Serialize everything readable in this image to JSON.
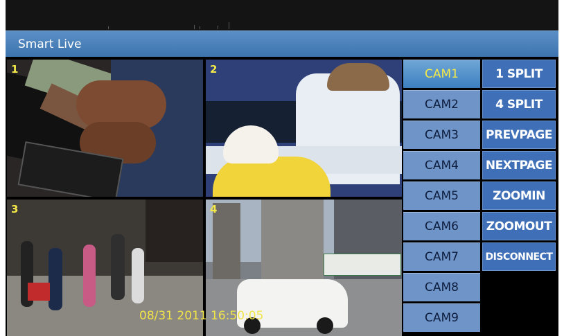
{
  "window": {
    "title": "Smart Live"
  },
  "tiles": [
    {
      "label": "1"
    },
    {
      "label": "2"
    },
    {
      "label": "3"
    },
    {
      "label": "4"
    }
  ],
  "overlay": {
    "timestamp": "08/31 2011 16:50:05"
  },
  "cameras": {
    "active": "CAM1",
    "items": [
      "CAM1",
      "CAM2",
      "CAM3",
      "CAM4",
      "CAM5",
      "CAM6",
      "CAM7",
      "CAM8",
      "CAM9"
    ]
  },
  "controls": [
    "1 SPLIT",
    "4 SPLIT",
    "PREVPAGE",
    "NEXTPAGE",
    "ZOOMIN",
    "ZOOMOUT",
    "DISCONNECT"
  ],
  "colors": {
    "titlebar": "#4a7fb8",
    "cam_button": "#6f95c8",
    "control_button": "#3f6fb7",
    "overlay_text": "#f3e94a"
  }
}
